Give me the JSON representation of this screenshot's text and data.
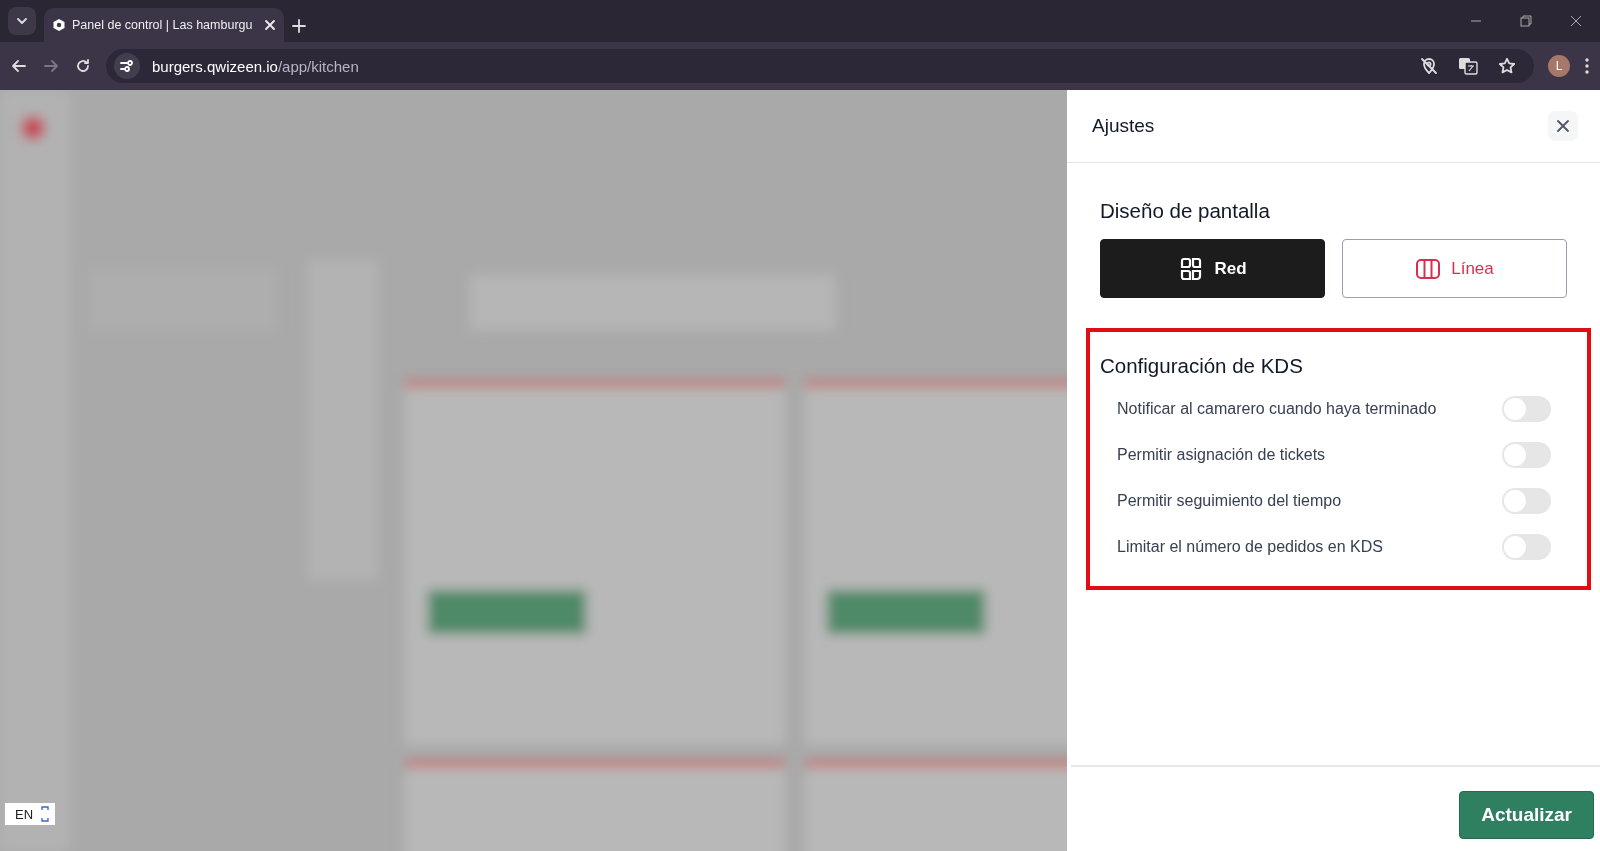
{
  "browser": {
    "tab_title": "Panel de control | Las hamburgu",
    "url_host": "burgers.qwizeen.io",
    "url_path": "/app/kitchen",
    "profile_initial": "L"
  },
  "language_widget": {
    "label": "EN"
  },
  "settings": {
    "title": "Ajustes",
    "layout_section": {
      "title": "Diseño de pantalla",
      "options": [
        {
          "label": "Red",
          "selected": true
        },
        {
          "label": "Línea",
          "selected": false
        }
      ]
    },
    "kds_section": {
      "title": "Configuración de KDS",
      "highlighted": true,
      "settings": [
        {
          "label": "Notificar al camarero cuando haya terminado",
          "on": false
        },
        {
          "label": "Permitir asignación de tickets",
          "on": false
        },
        {
          "label": "Permitir seguimiento del tiempo",
          "on": false
        },
        {
          "label": "Limitar el número de pedidos en KDS",
          "on": false
        }
      ]
    },
    "submit_label": "Actualizar"
  }
}
